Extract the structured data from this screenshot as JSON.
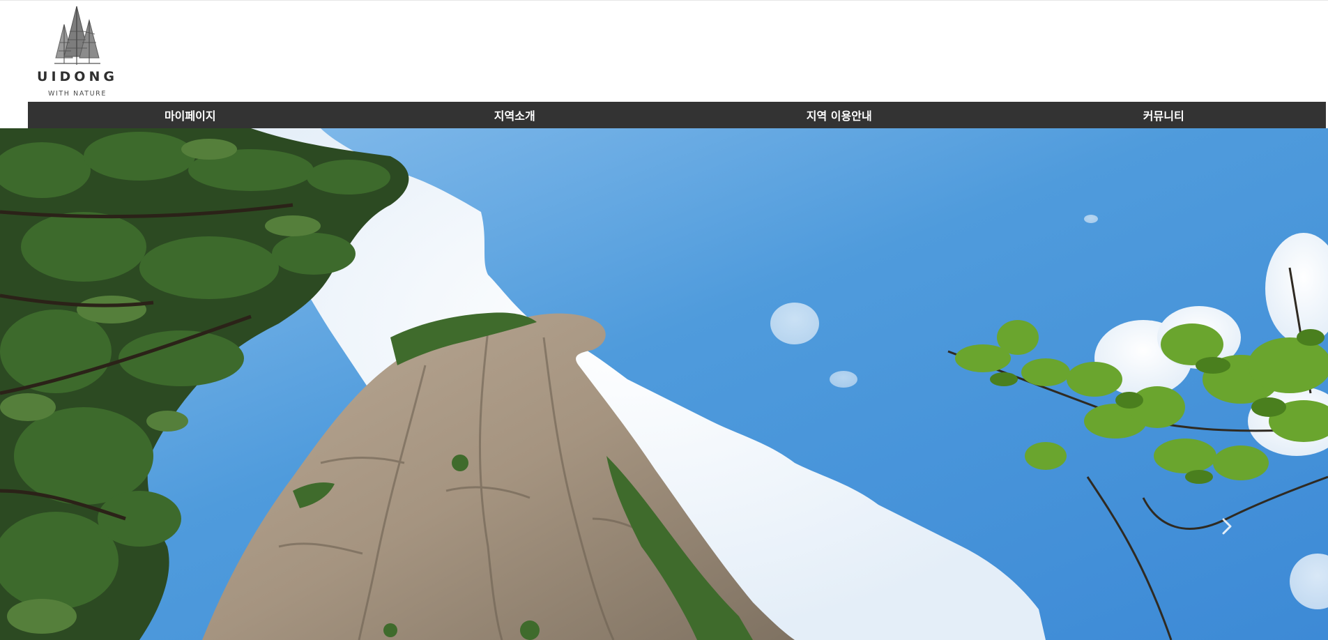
{
  "brand": {
    "title": "UIDONG",
    "subtitle": "WITH NATURE"
  },
  "nav": {
    "items": [
      {
        "label": "마이페이지"
      },
      {
        "label": "지역소개"
      },
      {
        "label": "지역 이용안내"
      },
      {
        "label": "커뮤니티"
      }
    ]
  },
  "hero": {
    "next_icon": "chevron-right-icon"
  },
  "colors": {
    "nav_background": "#333333",
    "nav_text": "#ffffff",
    "sky": "#5ea5e0",
    "logo_text": "#2f2f2f"
  }
}
